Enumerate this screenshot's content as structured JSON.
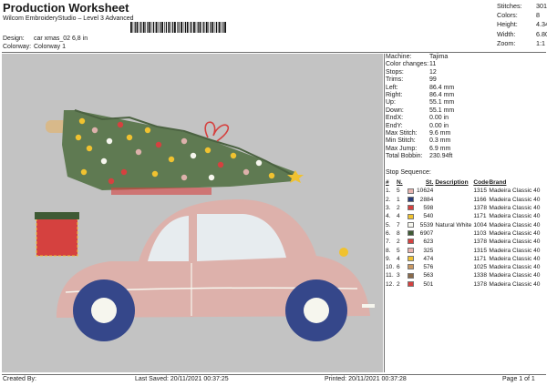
{
  "header": {
    "title": "Production Worksheet",
    "subtitle": "Wilcom EmbroideryStudio – Level 3 Advanced",
    "design_label": "Design:",
    "design_value": "car xmas_02 6,8 in",
    "colorway_label": "Colorway:",
    "colorway_value": "Colorway 1"
  },
  "stats": [
    {
      "label": "Stitches:",
      "value": "30156"
    },
    {
      "label": "Colors:",
      "value": "8"
    },
    {
      "label": "Height:",
      "value": "4.34 in"
    },
    {
      "label": "Width:",
      "value": "6.80 in"
    },
    {
      "label": "Zoom:",
      "value": "1:1"
    }
  ],
  "info": [
    {
      "label": "Machine:",
      "value": "Tajima"
    },
    {
      "label": "Color changes:",
      "value": "11"
    },
    {
      "label": "Stops:",
      "value": "12"
    },
    {
      "label": "Trims:",
      "value": "99"
    },
    {
      "label": "Left:",
      "value": "86.4 mm"
    },
    {
      "label": "Right:",
      "value": "86.4 mm"
    },
    {
      "label": "Up:",
      "value": "55.1 mm"
    },
    {
      "label": "Down:",
      "value": "55.1 mm"
    },
    {
      "label": "EndX:",
      "value": "0.00 in"
    },
    {
      "label": "EndY:",
      "value": "0.00 in"
    },
    {
      "label": "Max Stitch:",
      "value": "9.6 mm"
    },
    {
      "label": "Min Stitch:",
      "value": "0.3 mm"
    },
    {
      "label": "Max Jump:",
      "value": "6.9 mm"
    },
    {
      "label": "Total Bobbin:",
      "value": "230.94ft"
    }
  ],
  "stop_sequence": {
    "title": "Stop Sequence:",
    "headers": [
      "#",
      "N.",
      "",
      "St.",
      "Description",
      "Code",
      "Brand"
    ],
    "rows": [
      {
        "num": "1.",
        "n": "5",
        "color": "#e8b4b0",
        "st": "10624",
        "desc": "",
        "code": "1315",
        "brand": "Madeira Classic 40"
      },
      {
        "num": "2.",
        "n": "1",
        "color": "#2a3d7a",
        "st": "2884",
        "desc": "",
        "code": "1166",
        "brand": "Madeira Classic 40"
      },
      {
        "num": "3.",
        "n": "2",
        "color": "#d5413f",
        "st": "598",
        "desc": "",
        "code": "1378",
        "brand": "Madeira Classic 40"
      },
      {
        "num": "4.",
        "n": "4",
        "color": "#f0c230",
        "st": "540",
        "desc": "",
        "code": "1171",
        "brand": "Madeira Classic 40"
      },
      {
        "num": "5.",
        "n": "7",
        "color": "#f6f6ee",
        "st": "5539",
        "desc": "Natural White",
        "code": "1004",
        "brand": "Madeira Classic 40"
      },
      {
        "num": "6.",
        "n": "8",
        "color": "#3e5a34",
        "st": "6907",
        "desc": "",
        "code": "1103",
        "brand": "Madeira Classic 40"
      },
      {
        "num": "7.",
        "n": "2",
        "color": "#d5413f",
        "st": "623",
        "desc": "",
        "code": "1378",
        "brand": "Madeira Classic 40"
      },
      {
        "num": "8.",
        "n": "5",
        "color": "#e8b4b0",
        "st": "325",
        "desc": "",
        "code": "1315",
        "brand": "Madeira Classic 40"
      },
      {
        "num": "9.",
        "n": "4",
        "color": "#f0c230",
        "st": "474",
        "desc": "",
        "code": "1171",
        "brand": "Madeira Classic 40"
      },
      {
        "num": "10.",
        "n": "6",
        "color": "#c99762",
        "st": "576",
        "desc": "",
        "code": "1025",
        "brand": "Madeira Classic 40"
      },
      {
        "num": "11.",
        "n": "3",
        "color": "#8a6a4a",
        "st": "563",
        "desc": "",
        "code": "1338",
        "brand": "Madeira Classic 40"
      },
      {
        "num": "12.",
        "n": "2",
        "color": "#d5413f",
        "st": "501",
        "desc": "",
        "code": "1378",
        "brand": "Madeira Classic 40"
      }
    ]
  },
  "footer": {
    "created": "Created By:",
    "saved": "Last Saved: 20/11/2021 00:37:25",
    "printed": "Printed: 20/11/2021 00:37:28",
    "page": "Page 1 of 1"
  },
  "colors": {
    "canvas_bg": "#c3c3c3",
    "car_body": "#ddb1ab",
    "tree": "#5f7a52",
    "wheel": "#35478a",
    "window": "#e7ecef"
  }
}
